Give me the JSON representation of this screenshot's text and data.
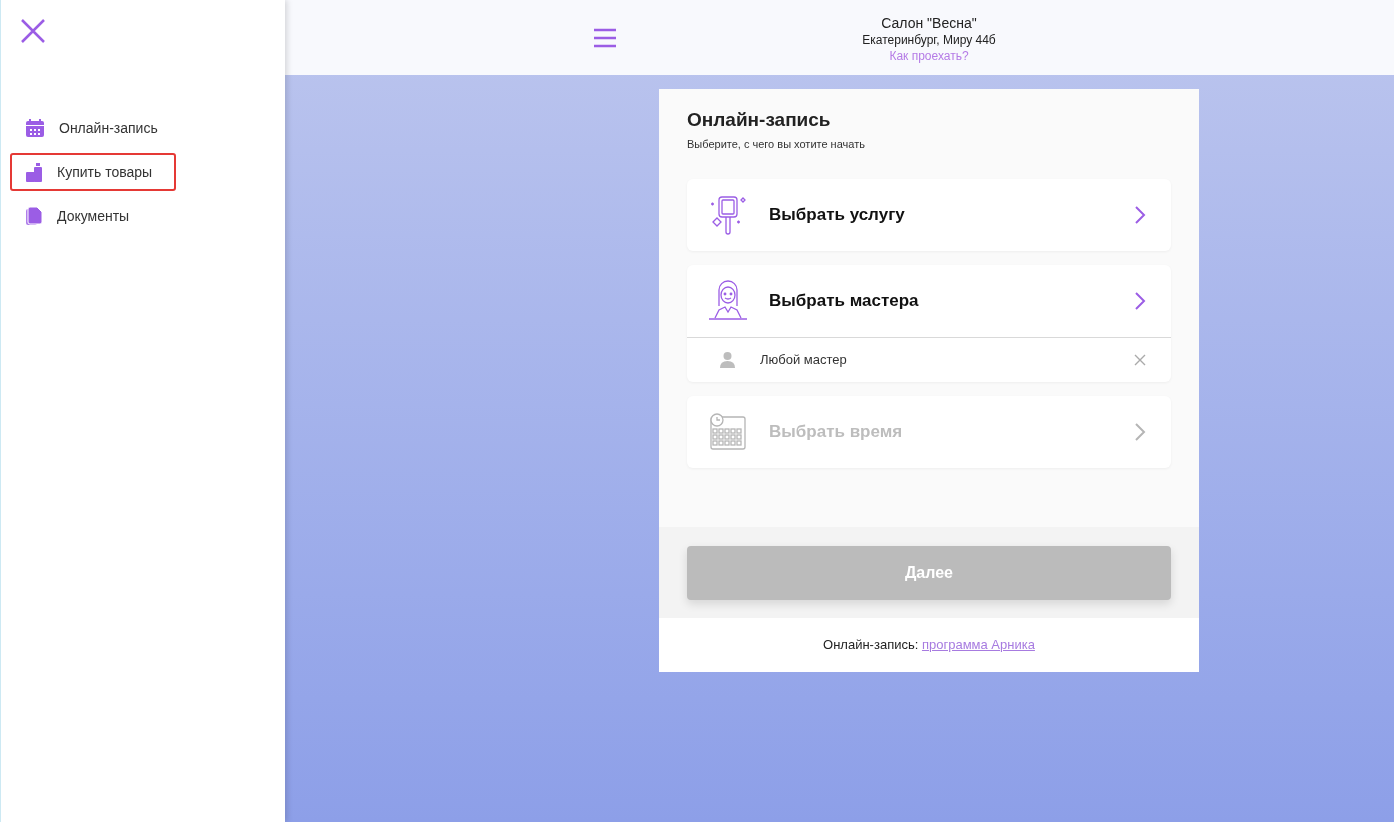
{
  "sidebar": {
    "items": [
      {
        "label": "Онлайн-запись",
        "kind": "calendar",
        "highlighted": false
      },
      {
        "label": "Купить товары",
        "kind": "products",
        "highlighted": true
      },
      {
        "label": "Документы",
        "kind": "documents",
        "highlighted": false
      }
    ]
  },
  "header": {
    "salon": "Салон \"Весна\"",
    "address": "Екатеринбург, Миру 44б",
    "directions_link": "Как проехать?"
  },
  "booking": {
    "title": "Онлайн-запись",
    "subtitle": "Выберите, с чего вы хотите начать",
    "steps": [
      {
        "kind": "service",
        "label": "Выбрать услугу",
        "disabled": false
      },
      {
        "kind": "master",
        "label": "Выбрать мастера",
        "disabled": false,
        "selection": "Любой мастер"
      },
      {
        "kind": "time",
        "label": "Выбрать время",
        "disabled": true
      }
    ],
    "next_button": {
      "label": "Далее",
      "disabled": true
    },
    "footer": {
      "text": "Онлайн-запись:",
      "link": "программа Арника"
    }
  }
}
